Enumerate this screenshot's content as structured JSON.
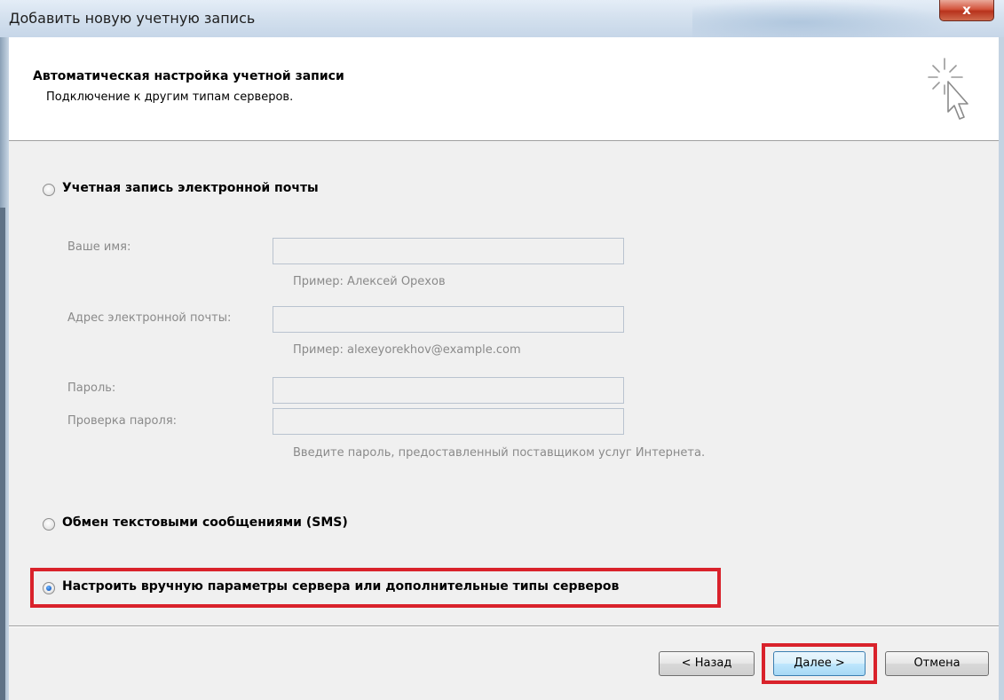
{
  "window": {
    "title": "Добавить новую учетную запись",
    "close_glyph": "x"
  },
  "header": {
    "title": "Автоматическая настройка учетной записи",
    "subtitle": "Подключение к другим типам серверов.",
    "icon": "wizard-cursor-icon"
  },
  "options": {
    "email_account": {
      "label": "Учетная запись электронной почты",
      "selected": false
    },
    "sms": {
      "label": "Обмен текстовыми сообщениями (SMS)",
      "selected": false
    },
    "manual": {
      "label": "Настроить вручную параметры сервера или дополнительные типы серверов",
      "selected": true
    }
  },
  "form": {
    "name": {
      "label": "Ваше имя:",
      "value": "",
      "hint": "Пример: Алексей Орехов"
    },
    "email": {
      "label": "Адрес электронной почты:",
      "value": "",
      "hint": "Пример: alexeyorekhov@example.com"
    },
    "password": {
      "label": "Пароль:",
      "value": ""
    },
    "password_confirm": {
      "label": "Проверка пароля:",
      "value": "",
      "hint": "Введите пароль, предоставленный поставщиком услуг Интернета."
    }
  },
  "buttons": {
    "back": "< Назад",
    "next": "Далее >",
    "cancel": "Отмена"
  },
  "colors": {
    "highlight": "#d9222b",
    "disabled_text": "#8a8a8a"
  }
}
